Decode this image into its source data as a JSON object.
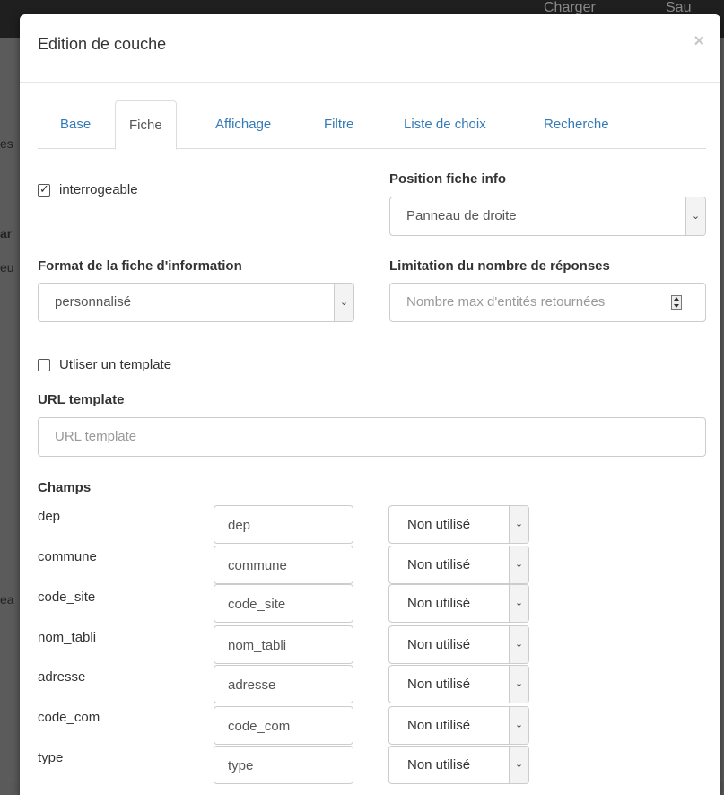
{
  "background": {
    "top_left_text": "Charger",
    "top_right_text": "Sau",
    "left_fragments": [
      "es",
      "ar",
      "eu",
      "ea"
    ]
  },
  "modal": {
    "title": "Edition de couche",
    "close_glyph": "×"
  },
  "tabs": [
    {
      "label": "Base",
      "active": false
    },
    {
      "label": "Fiche",
      "active": true
    },
    {
      "label": "Affichage",
      "active": false
    },
    {
      "label": "Filtre",
      "active": false
    },
    {
      "label": "Liste de choix",
      "active": false
    },
    {
      "label": "Recherche",
      "active": false
    }
  ],
  "fiche": {
    "interrogeable_label": "interrogeable",
    "interrogeable_checked": true,
    "position_label": "Position fiche info",
    "position_value": "Panneau de droite",
    "format_label": "Format de la fiche d'information",
    "format_value": "personnalisé",
    "limit_label": "Limitation du nombre de réponses",
    "limit_placeholder": "Nombre max d'entités retournées",
    "template_checkbox_label": "Utliser un template",
    "template_checked": false,
    "url_label": "URL template",
    "url_placeholder": "URL template",
    "champs_label": "Champs"
  },
  "fields": [
    {
      "name": "dep",
      "alias": "dep",
      "usage": "Non utilisé"
    },
    {
      "name": "commune",
      "alias": "commune",
      "usage": "Non utilisé"
    },
    {
      "name": "code_site",
      "alias": "code_site",
      "usage": "Non utilisé"
    },
    {
      "name": "nom_tabli",
      "alias": "nom_tabli",
      "usage": "Non utilisé"
    },
    {
      "name": "adresse",
      "alias": "adresse",
      "usage": "Non utilisé"
    },
    {
      "name": "code_com",
      "alias": "code_com",
      "usage": "Non utilisé"
    },
    {
      "name": "type",
      "alias": "type",
      "usage": "Non utilisé"
    }
  ],
  "icons": {
    "caret": "chevron-down-icon",
    "check": "check-icon"
  }
}
